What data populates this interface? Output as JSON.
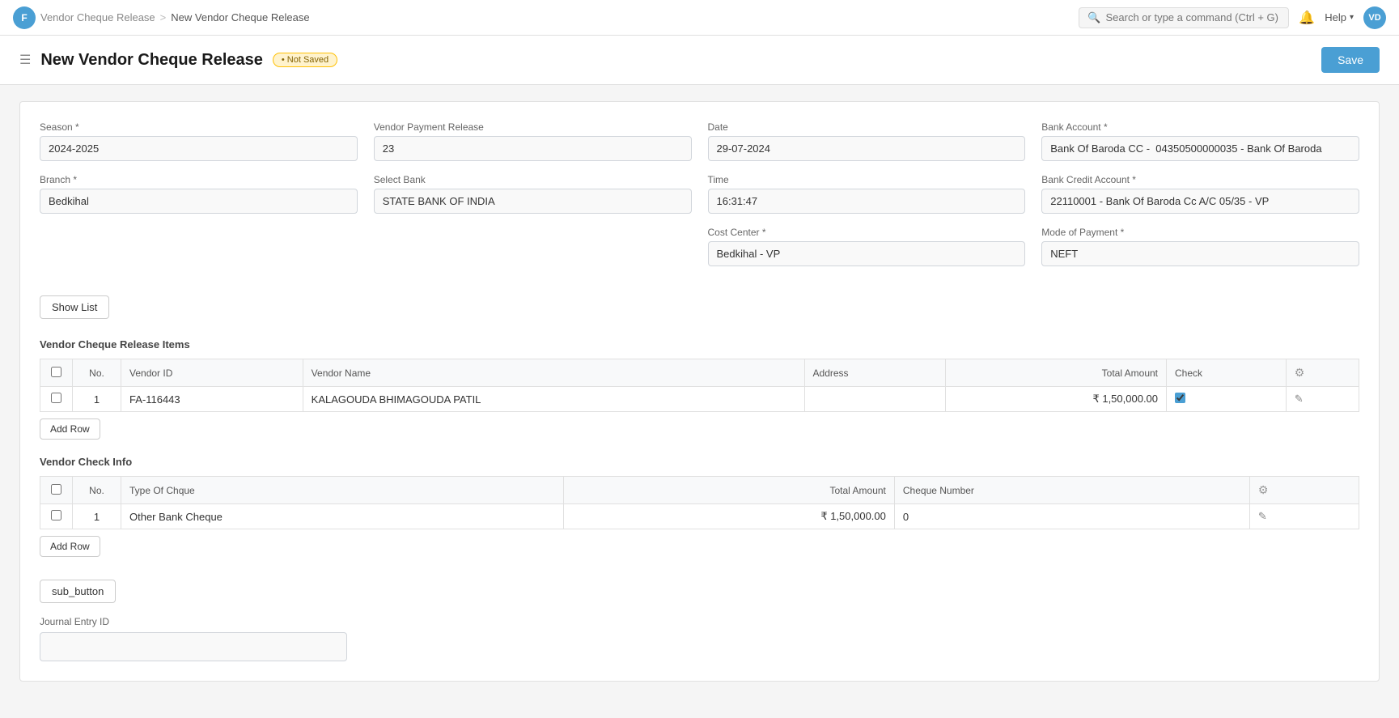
{
  "app": {
    "logo_text": "F",
    "avatar_text": "VD"
  },
  "breadcrumb": {
    "parent": "Vendor Cheque Release",
    "current": "New Vendor Cheque Release",
    "sep": ">"
  },
  "search": {
    "placeholder": "Search or type a command (Ctrl + G)"
  },
  "nav": {
    "help_label": "Help",
    "bell_icon": "🔔"
  },
  "page": {
    "title": "New Vendor Cheque Release",
    "status_badge": "• Not Saved",
    "save_button": "Save"
  },
  "form": {
    "season_label": "Season *",
    "season_value": "2024-2025",
    "vendor_payment_label": "Vendor Payment Release",
    "vendor_payment_value": "23",
    "date_label": "Date",
    "date_value": "29-07-2024",
    "bank_account_label": "Bank Account *",
    "bank_account_value": "Bank Of Baroda CC -  04350500000035 - Bank Of Baroda",
    "branch_label": "Branch *",
    "branch_value": "Bedkihal",
    "select_bank_label": "Select Bank",
    "select_bank_value": "STATE BANK OF INDIA",
    "time_label": "Time",
    "time_value": "16:31:47",
    "bank_credit_account_label": "Bank Credit Account *",
    "bank_credit_account_value": "22110001 - Bank Of Baroda Cc A/C 05/35 - VP",
    "cost_center_label": "Cost Center *",
    "cost_center_value": "Bedkihal - VP",
    "mode_of_payment_label": "Mode of Payment *",
    "mode_of_payment_value": "NEFT"
  },
  "show_list_button": "Show List",
  "vendor_items_section": {
    "title": "Vendor Cheque Release Items",
    "columns": [
      "",
      "No.",
      "Vendor ID",
      "Vendor Name",
      "Address",
      "Total Amount",
      "Check",
      ""
    ],
    "rows": [
      {
        "no": "1",
        "vendor_id": "FA-116443",
        "vendor_name": "KALAGOUDA BHIMAGOUDA PATIL",
        "address": "",
        "total_amount": "₹ 1,50,000.00",
        "check": true
      }
    ],
    "add_row_button": "Add Row"
  },
  "vendor_check_section": {
    "title": "Vendor Check Info",
    "columns": [
      "",
      "No.",
      "Type Of Chque",
      "Total Amount",
      "Cheque Number",
      ""
    ],
    "rows": [
      {
        "no": "1",
        "type": "Other Bank Cheque",
        "total_amount": "₹ 1,50,000.00",
        "cheque_number": "0"
      }
    ],
    "add_row_button": "Add Row"
  },
  "sub_button_label": "sub_button",
  "journal_entry": {
    "label": "Journal Entry ID",
    "value": ""
  }
}
